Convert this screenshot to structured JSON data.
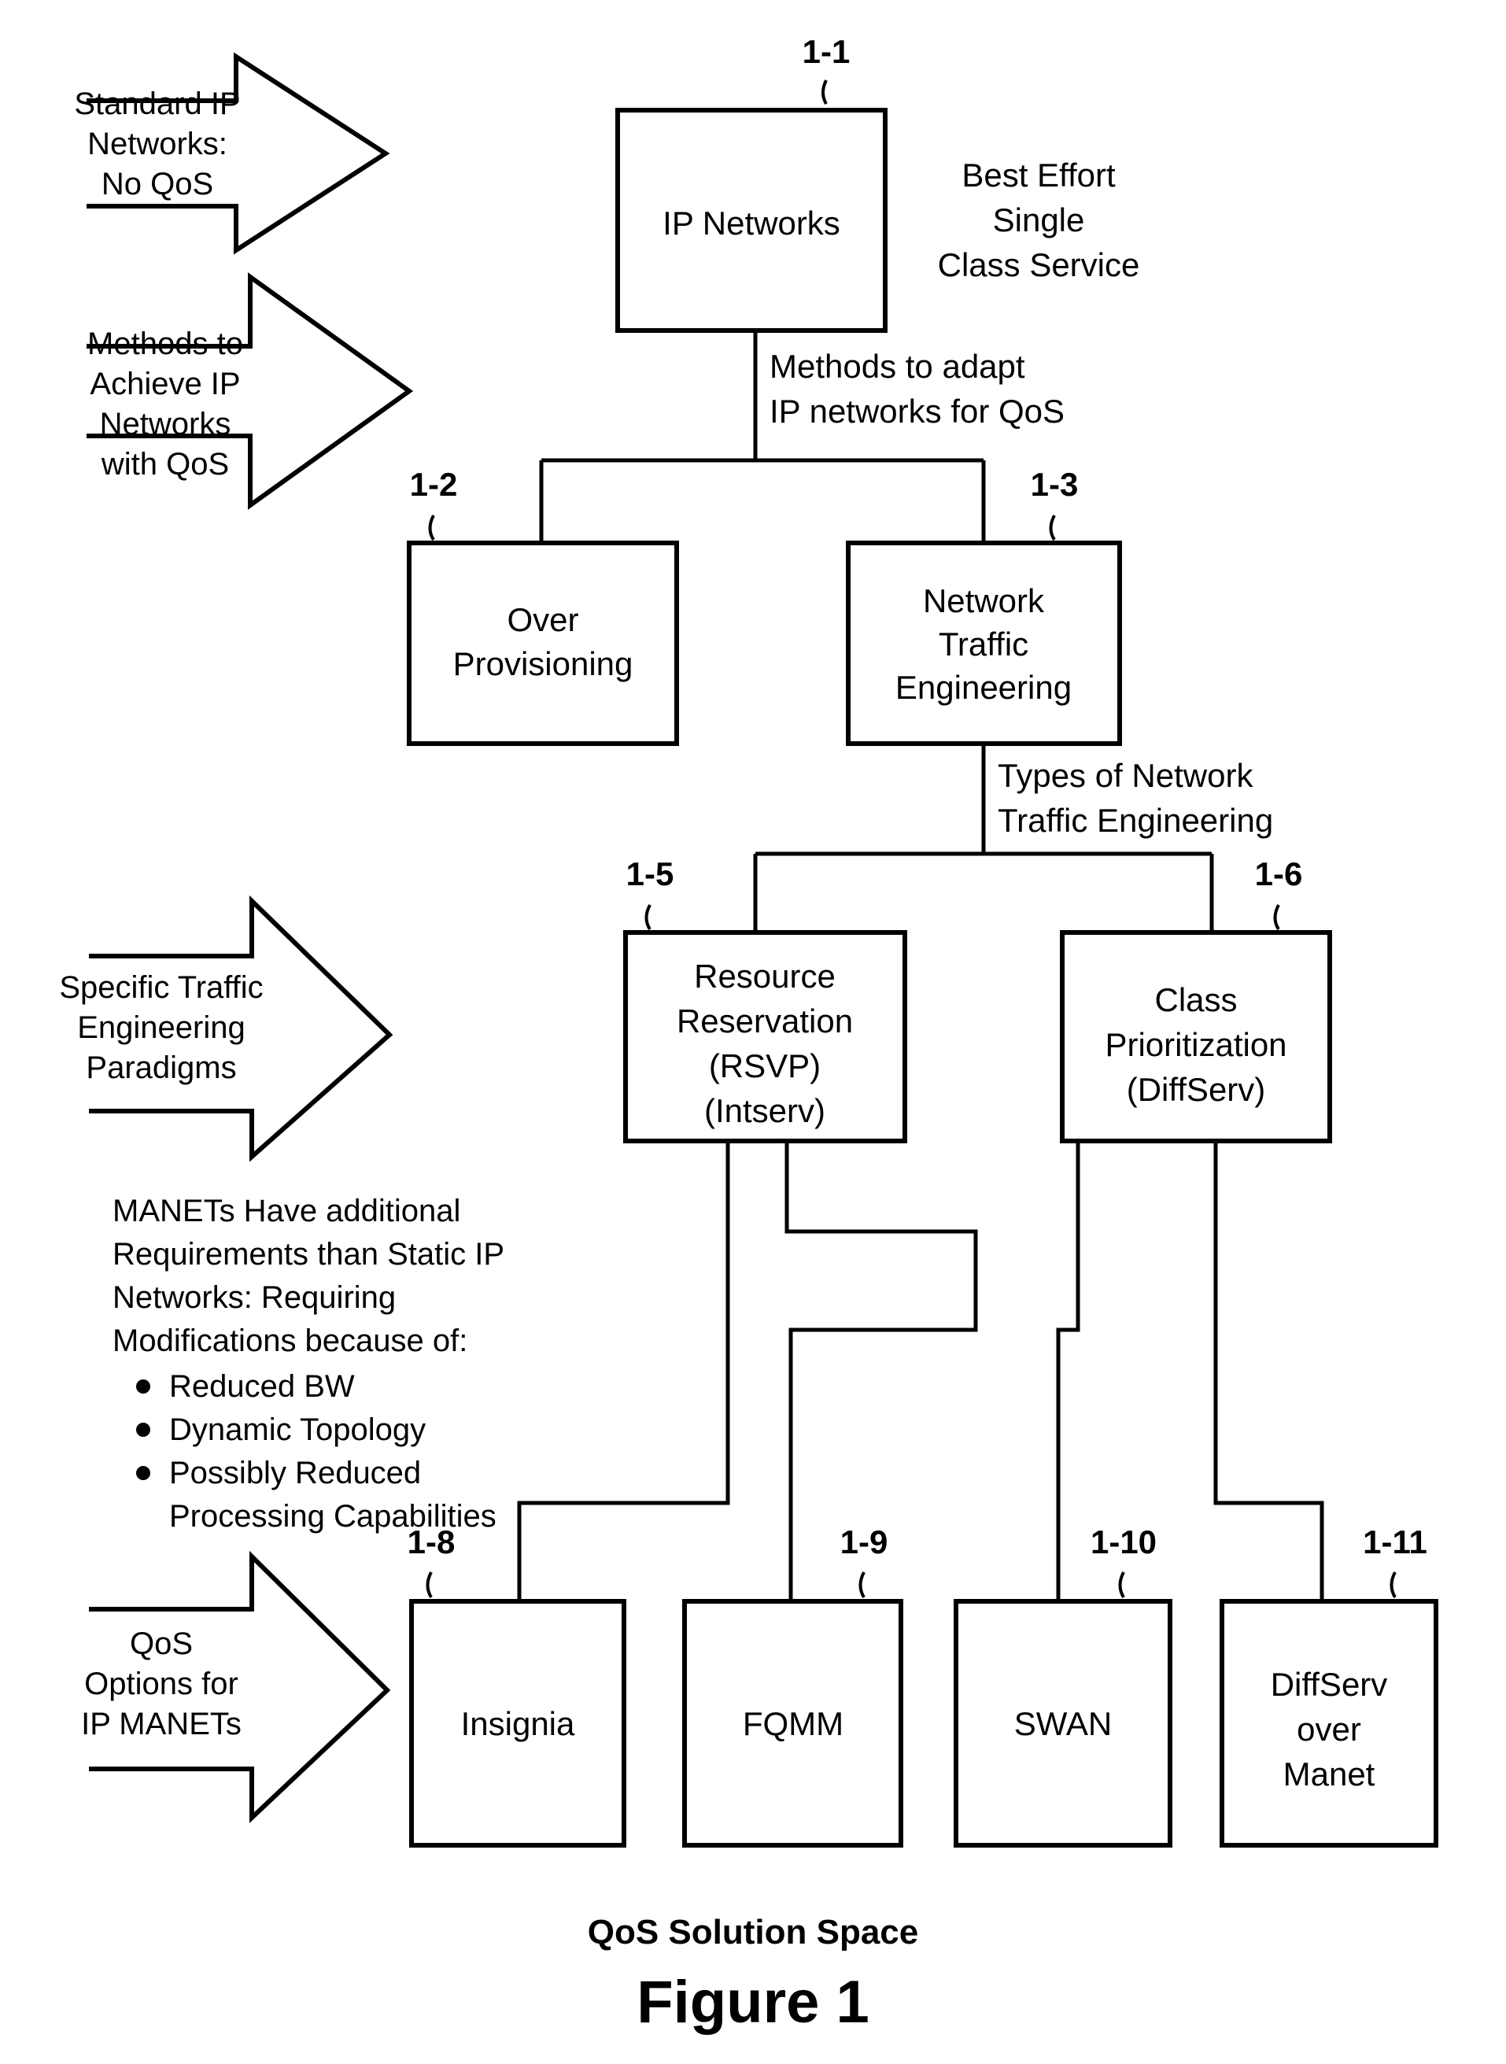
{
  "figure": {
    "caption_subtitle": "QoS Solution Space",
    "caption_title": "Figure 1",
    "ink_color": "#000000",
    "background_color": "#ffffff"
  },
  "band_arrows": [
    {
      "id": "standard-ip-networks",
      "lines": [
        "Standard IP",
        "Networks:",
        "No QoS"
      ]
    },
    {
      "id": "methods-achieve-qos",
      "lines": [
        "Methods to",
        "Achieve IP",
        "Networks",
        "with QoS"
      ]
    },
    {
      "id": "specific-traffic-paradigms",
      "lines": [
        "Specific Traffic",
        "Engineering",
        "Paradigms"
      ]
    },
    {
      "id": "qos-options-manets",
      "lines": [
        "QoS",
        "Options for",
        "IP MANETs"
      ]
    }
  ],
  "nodes": [
    {
      "id": "ip-networks",
      "ref": "1-1",
      "lines": [
        "IP Networks"
      ]
    },
    {
      "id": "over-provisioning",
      "ref": "1-2",
      "lines": [
        "Over",
        "Provisioning"
      ]
    },
    {
      "id": "network-traffic-eng",
      "ref": "1-3",
      "lines": [
        "Network",
        "Traffic",
        "Engineering"
      ]
    },
    {
      "id": "resource-reservation",
      "ref": "1-5",
      "lines": [
        "Resource",
        "Reservation",
        "(RSVP)",
        "(Intserv)"
      ]
    },
    {
      "id": "class-prioritization",
      "ref": "1-6",
      "lines": [
        "Class",
        "Prioritization",
        "(DiffServ)"
      ]
    },
    {
      "id": "insignia",
      "ref": "1-8",
      "lines": [
        "Insignia"
      ]
    },
    {
      "id": "fqmm",
      "ref": "1-9",
      "lines": [
        "FQMM"
      ]
    },
    {
      "id": "swan",
      "ref": "1-10",
      "lines": [
        "SWAN"
      ]
    },
    {
      "id": "diffserv-over-manet",
      "ref": "1-11",
      "lines": [
        "DiffServ",
        "over",
        "Manet"
      ]
    }
  ],
  "annotations": {
    "best_effort": [
      "Best Effort",
      "Single",
      "Class Service"
    ],
    "methods_to_adapt": [
      "Methods to adapt",
      "IP networks for QoS"
    ],
    "types_of_te": [
      "Types of Network",
      "Traffic Engineering"
    ]
  },
  "manet_note": {
    "paragraph": [
      "MANETs Have additional",
      "Requirements than Static IP",
      "Networks: Requiring",
      "Modifications because of:"
    ],
    "bullets": [
      [
        "Reduced BW"
      ],
      [
        "Dynamic Topology"
      ],
      [
        "Possibly Reduced",
        "Processing Capabilities"
      ]
    ]
  }
}
